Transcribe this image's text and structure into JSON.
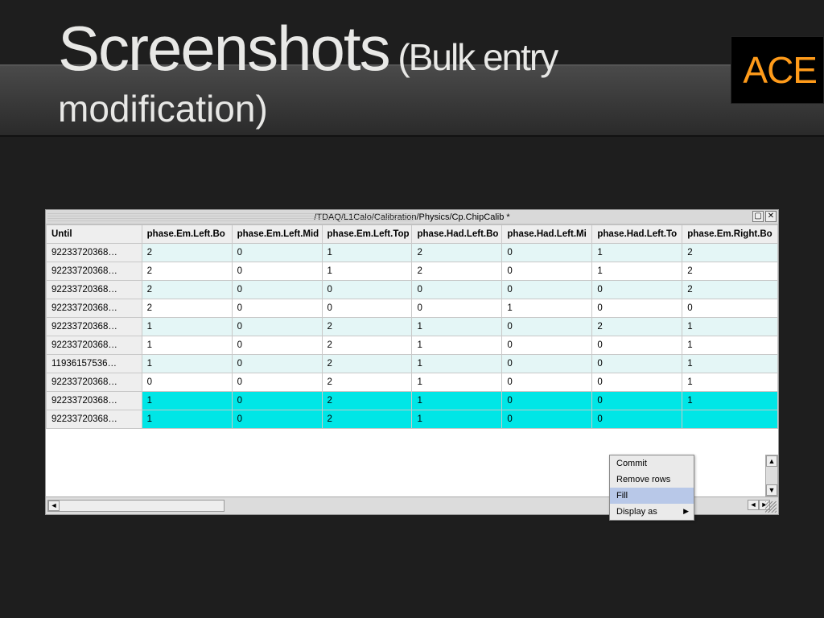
{
  "slide": {
    "title_bold": "Screenshots",
    "title_rest": " (Bulk entry",
    "subtitle": "modification)",
    "logo": "ACE"
  },
  "panel": {
    "path": "/TDAQ/L1Calo/Calibration/Physics/Cp.ChipCalib *",
    "columns": [
      "Until",
      "phase.Em.Left.Bo",
      "phase.Em.Left.Mid",
      "phase.Em.Left.Top",
      "phase.Had.Left.Bo",
      "phase.Had.Left.Mi",
      "phase.Had.Left.To",
      "phase.Em.Right.Bo"
    ],
    "rows": [
      {
        "until": "92233720368…",
        "v": [
          "2",
          "0",
          "1",
          "2",
          "0",
          "1",
          "2"
        ],
        "sel": false
      },
      {
        "until": "92233720368…",
        "v": [
          "2",
          "0",
          "1",
          "2",
          "0",
          "1",
          "2"
        ],
        "sel": false
      },
      {
        "until": "92233720368…",
        "v": [
          "2",
          "0",
          "0",
          "0",
          "0",
          "0",
          "2"
        ],
        "sel": false
      },
      {
        "until": "92233720368…",
        "v": [
          "2",
          "0",
          "0",
          "0",
          "1",
          "0",
          "0"
        ],
        "sel": false
      },
      {
        "until": "92233720368…",
        "v": [
          "1",
          "0",
          "2",
          "1",
          "0",
          "2",
          "1"
        ],
        "sel": false
      },
      {
        "until": "92233720368…",
        "v": [
          "1",
          "0",
          "2",
          "1",
          "0",
          "0",
          "1"
        ],
        "sel": false
      },
      {
        "until": "11936157536…",
        "v": [
          "1",
          "0",
          "2",
          "1",
          "0",
          "0",
          "1"
        ],
        "sel": false
      },
      {
        "until": "92233720368…",
        "v": [
          "0",
          "0",
          "2",
          "1",
          "0",
          "0",
          "1"
        ],
        "sel": false
      },
      {
        "until": "92233720368…",
        "v": [
          "1",
          "0",
          "2",
          "1",
          "0",
          "0",
          "1"
        ],
        "sel": true
      },
      {
        "until": "92233720368…",
        "v": [
          "1",
          "0",
          "2",
          "1",
          "0",
          "0",
          ""
        ],
        "sel": true
      }
    ]
  },
  "menu": {
    "items": [
      {
        "label": "Commit",
        "hl": false
      },
      {
        "label": "Remove rows",
        "hl": false
      },
      {
        "label": "Fill",
        "hl": true
      },
      {
        "label": "Display as",
        "hl": false,
        "sub": true
      }
    ]
  }
}
